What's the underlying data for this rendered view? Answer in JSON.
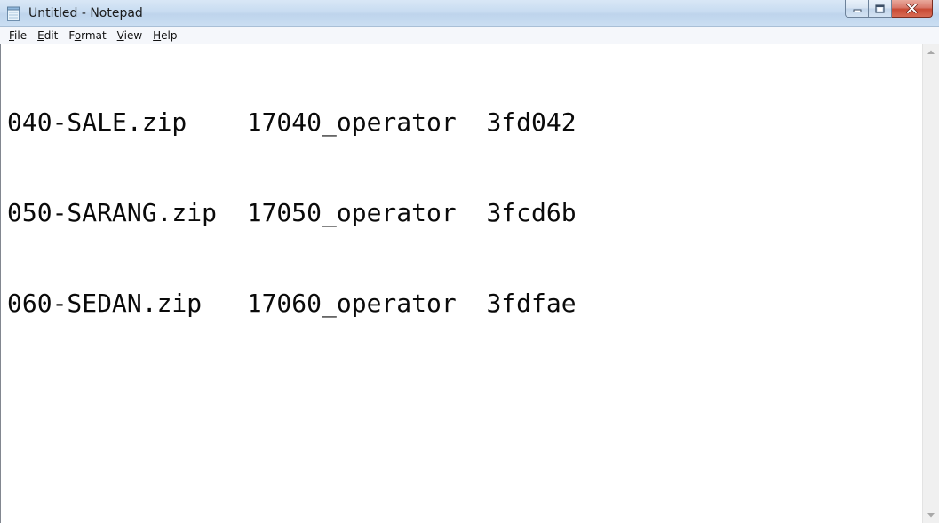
{
  "window": {
    "title": "Untitled - Notepad",
    "app_icon": "notepad-icon",
    "caption_buttons": [
      {
        "name": "minimize",
        "icon": "minimize-icon"
      },
      {
        "name": "maximize",
        "icon": "maximize-icon"
      },
      {
        "name": "close",
        "icon": "close-icon",
        "color": "#c84a34"
      }
    ]
  },
  "menu": {
    "items": [
      {
        "label_first": "F",
        "label_rest": "ile"
      },
      {
        "label_first": "E",
        "label_rest": "dit"
      },
      {
        "label_first": "F",
        "label_pre": "",
        "label_underlined": "o",
        "label_rest": "rmat"
      },
      {
        "label_first": "V",
        "label_rest": "iew"
      },
      {
        "label_first": "H",
        "label_rest": "elp"
      }
    ]
  },
  "editor": {
    "lines": [
      "040-SALE.zip    17040_operator  3fd042",
      "050-SARANG.zip  17050_operator  3fcd6b",
      "060-SEDAN.zip   17060_operator  3fdfae"
    ]
  },
  "scrollbar": {
    "up_icon": "scroll-up-arrow-icon",
    "down_icon": "scroll-down-arrow-icon"
  }
}
